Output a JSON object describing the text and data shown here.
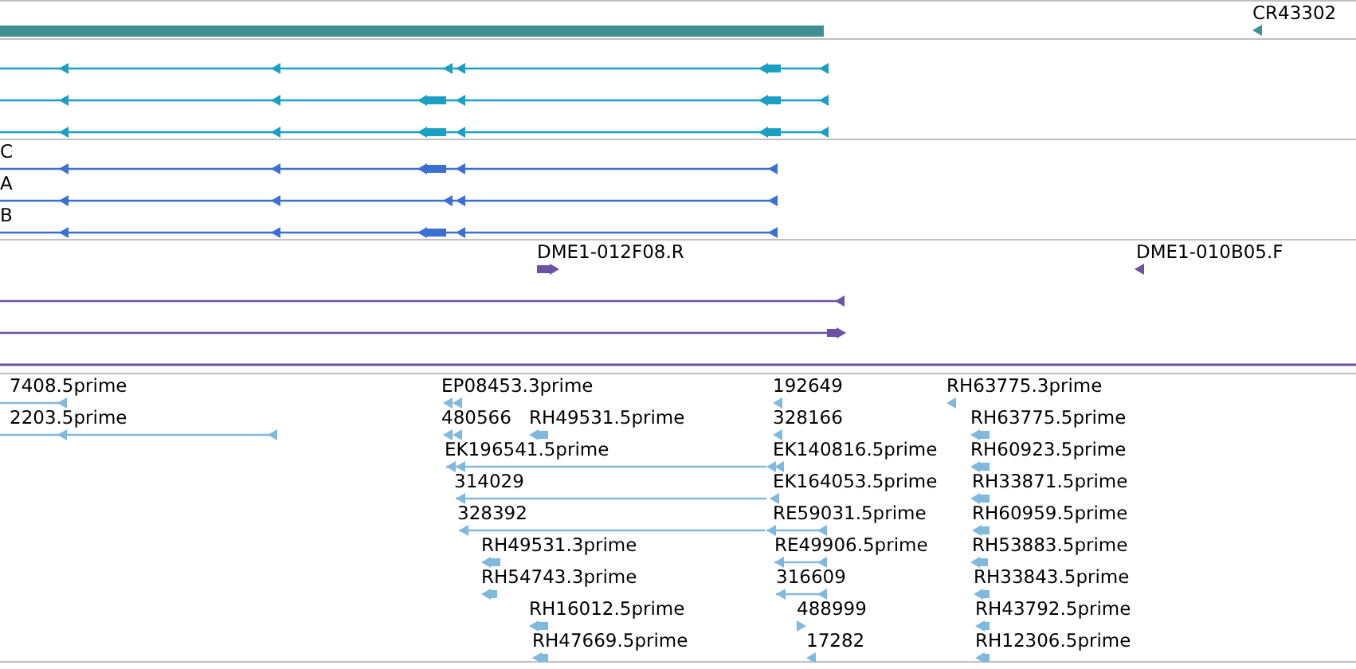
{
  "tracks": [
    {
      "kind": "gene",
      "color": "#3f8f93",
      "span_bar": true,
      "features": [
        {
          "label": "CR43302",
          "reverse": true
        }
      ]
    },
    {
      "kind": "transcript",
      "color": "#1aa0c2",
      "features": [
        {
          "reverse": true
        },
        {
          "reverse": true
        },
        {
          "reverse": true
        }
      ]
    },
    {
      "kind": "transcript",
      "color": "#3b6fd0",
      "features": [
        {
          "label": "C",
          "reverse": true
        },
        {
          "label": "A",
          "reverse": true
        },
        {
          "label": "B",
          "reverse": true
        }
      ]
    },
    {
      "kind": "clone",
      "color": "#6b52a3",
      "features": [
        {
          "label": "DME1-012F08.R",
          "reverse": false
        },
        {
          "label": "DME1-010B05.F",
          "reverse": true
        },
        {
          "reverse": true
        },
        {
          "reverse": false
        }
      ]
    },
    {
      "kind": "est",
      "color": "#80b9dd",
      "features": [
        {
          "label": "7408.5prime",
          "reverse": true
        },
        {
          "label": "EP08453.3prime",
          "reverse": true
        },
        {
          "label": "192649",
          "reverse": true
        },
        {
          "label": "RH63775.3prime",
          "reverse": true
        },
        {
          "label": "2203.5prime",
          "reverse": true
        },
        {
          "label": "480566",
          "reverse": true
        },
        {
          "label": "RH49531.5prime",
          "reverse": true
        },
        {
          "label": "328166",
          "reverse": true
        },
        {
          "label": "RH63775.5prime",
          "reverse": true
        },
        {
          "label": "EK196541.5prime",
          "reverse": true
        },
        {
          "label": "EK140816.5prime",
          "reverse": true
        },
        {
          "label": "RH60923.5prime",
          "reverse": true
        },
        {
          "label": "314029",
          "reverse": true
        },
        {
          "label": "EK164053.5prime",
          "reverse": true
        },
        {
          "label": "RH33871.5prime",
          "reverse": true
        },
        {
          "label": "328392",
          "reverse": true
        },
        {
          "label": "RE59031.5prime",
          "reverse": true
        },
        {
          "label": "RH60959.5prime",
          "reverse": true
        },
        {
          "label": "RH49531.3prime",
          "reverse": true
        },
        {
          "label": "RE49906.5prime",
          "reverse": true
        },
        {
          "label": "RH53883.5prime",
          "reverse": true
        },
        {
          "label": "RH54743.3prime",
          "reverse": true
        },
        {
          "label": "316609",
          "reverse": true
        },
        {
          "label": "RH33843.5prime",
          "reverse": true
        },
        {
          "label": "RH16012.5prime",
          "reverse": true
        },
        {
          "label": "488999",
          "reverse": false
        },
        {
          "label": "RH43792.5prime",
          "reverse": true
        },
        {
          "label": "RH47669.5prime",
          "reverse": true
        },
        {
          "label": "17282",
          "reverse": true
        },
        {
          "label": "RH12306.5prime",
          "reverse": true
        }
      ]
    }
  ]
}
